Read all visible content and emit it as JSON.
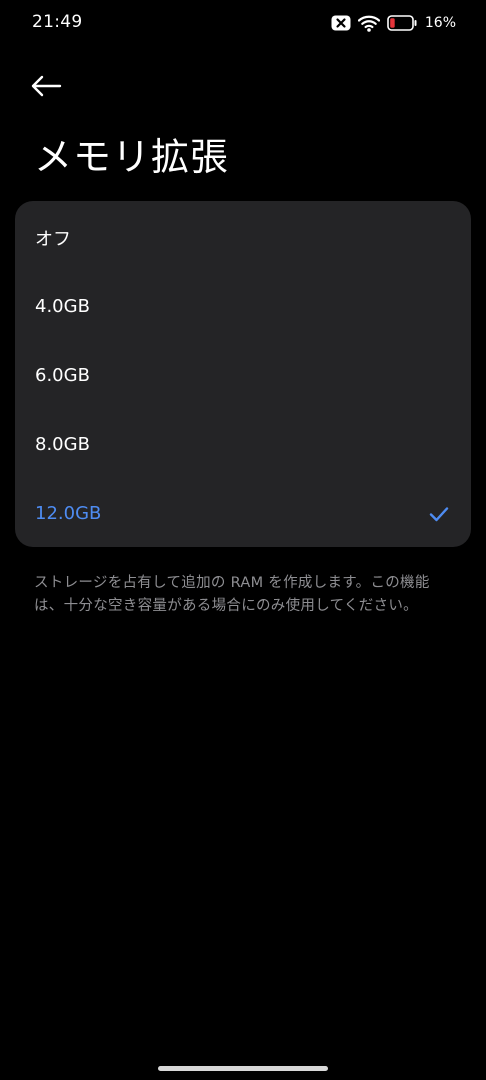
{
  "status_bar": {
    "time": "21:49",
    "battery_percent": "16%",
    "battery_level": 0.16,
    "icons": [
      "data-saver-off-icon",
      "wifi-icon",
      "battery-icon"
    ]
  },
  "header": {
    "back_icon": "back-arrow-icon",
    "title": "メモリ拡張"
  },
  "options": [
    {
      "label": "オフ",
      "selected": false
    },
    {
      "label": "4.0GB",
      "selected": false
    },
    {
      "label": "6.0GB",
      "selected": false
    },
    {
      "label": "8.0GB",
      "selected": false
    },
    {
      "label": "12.0GB",
      "selected": true
    }
  ],
  "description": "ストレージを占有して追加の RAM を作成します。この機能は、十分な空き容量がある場合にのみ使用してください。",
  "colors": {
    "background": "#000000",
    "card": "#242426",
    "accent": "#4e8cf2",
    "secondary_text": "#8e8e92",
    "battery_low": "#e5353b"
  }
}
